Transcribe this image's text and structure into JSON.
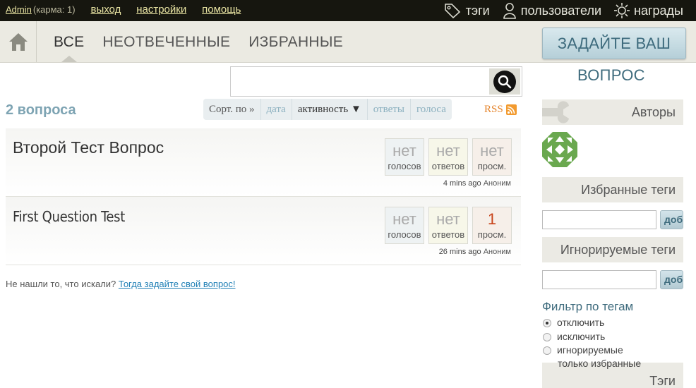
{
  "topbar": {
    "user": "Admin",
    "karma": "(карма: 1)",
    "links": [
      "выход",
      "настройки",
      "помощь"
    ],
    "nav": [
      {
        "label": "тэги",
        "icon": "tag-icon"
      },
      {
        "label": "пользователи",
        "icon": "user-icon"
      },
      {
        "label": "награды",
        "icon": "badge-icon"
      }
    ]
  },
  "nav": {
    "tabs": [
      "ВСЕ",
      "НЕОТВЕЧЕННЫЕ",
      "ИЗБРАННЫЕ"
    ],
    "active_tab": "ВСЕ",
    "ask_button": "ЗАДАЙТЕ ВАШ",
    "ask_button_cont": "ВОПРОС"
  },
  "search": {
    "value": "",
    "placeholder": ""
  },
  "list": {
    "count": "2 вопроса",
    "sort_label": "Сорт. по »",
    "sort_options": [
      "дата",
      "активность ▼",
      "ответы",
      "голоса"
    ],
    "active_sort": "активность ▼",
    "rss": "RSS"
  },
  "questions": [
    {
      "title": "Второй Тест Вопрос",
      "votes": "нет",
      "votes_label": "голосов",
      "answers": "нет",
      "answers_label": "ответов",
      "views": "нет",
      "views_label": "просм.",
      "ago": "4 mins ago",
      "author": "Аноним"
    },
    {
      "title": "First Question Test",
      "votes": "нет",
      "votes_label": "голосов",
      "answers": "нет",
      "answers_label": "ответов",
      "views": "1",
      "views_label": "просм.",
      "ago": "26 mins ago",
      "author": "Аноним"
    }
  ],
  "not_found": {
    "text": "Не нашли то, что искали?",
    "link": "Тогда задайте свой вопрос!"
  },
  "sidebar": {
    "authors": "Авторы",
    "favorite_tags": "Избранные теги",
    "ignored_tags": "Игнорируемые теги",
    "add_button": "добавить",
    "filter_title": "Фильтр по тегам",
    "filter_options": [
      "отключить",
      "исключить",
      "игнорируемые",
      "только избранные"
    ],
    "filter_selected": "отключить",
    "tags": "Тэги"
  },
  "colors": {
    "topbar": "#16160f",
    "topbar_link": "#e8e3a2",
    "accent": "#3e6b7d",
    "count": "#7ea4b3",
    "hot_views": "#c8441b",
    "rss": "#e5832a"
  }
}
